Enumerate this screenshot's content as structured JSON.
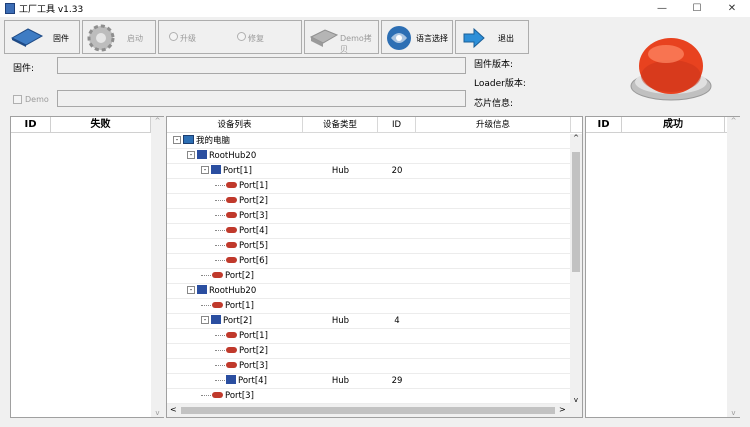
{
  "window": {
    "title": "工厂工具 v1.33",
    "min": "—",
    "max": "☐",
    "close": "✕"
  },
  "toolbar": {
    "firmware": "固件",
    "start": "启动",
    "upgrade": "升级",
    "repair": "修复",
    "demo_copy": "Demo拷贝",
    "language": "语言选择",
    "exit": "退出"
  },
  "form": {
    "firmware_label": "固件:",
    "demo_label": "Demo",
    "firmware_version": "固件版本:",
    "loader_version": "Loader版本:",
    "chip_info": "芯片信息:"
  },
  "left_panel": {
    "col_id": "ID",
    "col_name": "失败"
  },
  "right_panel": {
    "col_id": "ID",
    "col_name": "成功"
  },
  "device_table": {
    "headers": [
      "设备列表",
      "设备类型",
      "ID",
      "升级信息"
    ],
    "rows": [
      {
        "name": "我的电脑",
        "type": "",
        "id": "",
        "kind": "pc",
        "level": 0,
        "box": "-"
      },
      {
        "name": "RootHub20",
        "type": "",
        "id": "",
        "kind": "hub",
        "level": 1,
        "box": "-"
      },
      {
        "name": "Port[1]",
        "type": "Hub",
        "id": "20",
        "kind": "hub",
        "level": 2,
        "box": "-"
      },
      {
        "name": "Port[1]",
        "type": "",
        "id": "",
        "kind": "usb",
        "level": 3,
        "box": ""
      },
      {
        "name": "Port[2]",
        "type": "",
        "id": "",
        "kind": "usb",
        "level": 3,
        "box": ""
      },
      {
        "name": "Port[3]",
        "type": "",
        "id": "",
        "kind": "usb",
        "level": 3,
        "box": ""
      },
      {
        "name": "Port[4]",
        "type": "",
        "id": "",
        "kind": "usb",
        "level": 3,
        "box": ""
      },
      {
        "name": "Port[5]",
        "type": "",
        "id": "",
        "kind": "usb",
        "level": 3,
        "box": ""
      },
      {
        "name": "Port[6]",
        "type": "",
        "id": "",
        "kind": "usb",
        "level": 3,
        "box": ""
      },
      {
        "name": "Port[2]",
        "type": "",
        "id": "",
        "kind": "usb",
        "level": 2,
        "box": ""
      },
      {
        "name": "RootHub20",
        "type": "",
        "id": "",
        "kind": "hub",
        "level": 1,
        "box": "-"
      },
      {
        "name": "Port[1]",
        "type": "",
        "id": "",
        "kind": "usb",
        "level": 2,
        "box": ""
      },
      {
        "name": "Port[2]",
        "type": "Hub",
        "id": "4",
        "kind": "hub",
        "level": 2,
        "box": "-"
      },
      {
        "name": "Port[1]",
        "type": "",
        "id": "",
        "kind": "usb",
        "level": 3,
        "box": ""
      },
      {
        "name": "Port[2]",
        "type": "",
        "id": "",
        "kind": "usb",
        "level": 3,
        "box": ""
      },
      {
        "name": "Port[3]",
        "type": "",
        "id": "",
        "kind": "usb",
        "level": 3,
        "box": ""
      },
      {
        "name": "Port[4]",
        "type": "Hub",
        "id": "29",
        "kind": "hub",
        "level": 3,
        "box": ""
      },
      {
        "name": "Port[3]",
        "type": "",
        "id": "",
        "kind": "usb",
        "level": 2,
        "box": ""
      }
    ]
  },
  "colors": {
    "big_button": "#e8421f",
    "accent": "#2d6fb4"
  }
}
